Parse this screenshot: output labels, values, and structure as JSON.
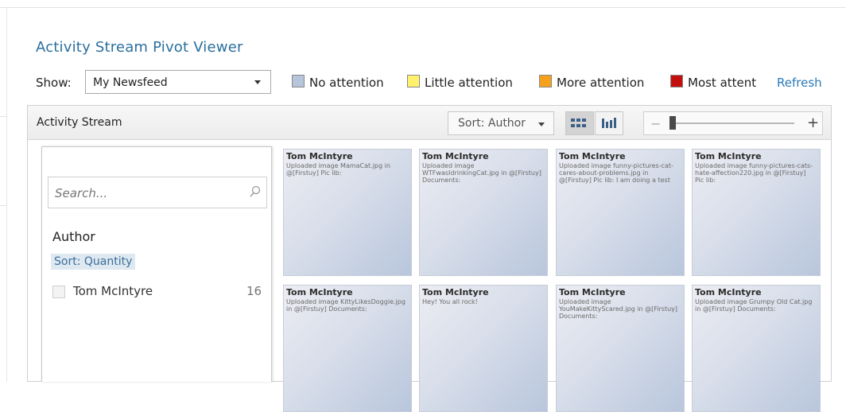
{
  "app": {
    "title": "Activity Stream Pivot Viewer"
  },
  "toolbar": {
    "show_label": "Show:",
    "show_value": "My Newsfeed",
    "refresh_label": "Refresh"
  },
  "legend": [
    {
      "label": "No attention",
      "color": "#b7c5dc"
    },
    {
      "label": "Little attention",
      "color": "#fff16b"
    },
    {
      "label": "More attention",
      "color": "#f6a11b"
    },
    {
      "label": "Most attent",
      "color": "#c40d0d"
    }
  ],
  "panel": {
    "title": "Activity Stream",
    "sort_label": "Sort: Author",
    "zoom_minus": "−",
    "zoom_plus": "+"
  },
  "filter": {
    "search_placeholder": "Search...",
    "facet_title": "Author",
    "sort_label": "Sort: Quantity",
    "items": [
      {
        "name": "Tom McIntyre",
        "count": "16"
      }
    ]
  },
  "cards": [
    {
      "author": "Tom McIntyre",
      "message": "Uploaded image MamaCat.jpg in @[Firstuy] Pic lib:"
    },
    {
      "author": "Tom McIntyre",
      "message": "Uploaded image WTFwasIdrinkingCat.jpg in @[Firstuy] Documents:"
    },
    {
      "author": "Tom McIntyre",
      "message": "Uploaded image funny-pictures-cat-cares-about-problems.jpg in @[Firstuy] Pic lib: I am doing a test"
    },
    {
      "author": "Tom McIntyre",
      "message": "Uploaded image funny-pictures-cats-hate-affection220.jpg in @[Firstuy] Pic lib:"
    },
    {
      "author": "Tom McIntyre",
      "message": "Uploaded image KittyLikesDoggie.jpg in @[Firstuy] Documents:"
    },
    {
      "author": "Tom McIntyre",
      "message": "Hey!  You all rock!"
    },
    {
      "author": "Tom McIntyre",
      "message": "Uploaded image YouMakeKittyScared.jpg in @[Firstuy] Documents:"
    },
    {
      "author": "Tom McIntyre",
      "message": "Uploaded image Grumpy Old Cat.jpg in @[Firstuy] Documents:"
    }
  ]
}
